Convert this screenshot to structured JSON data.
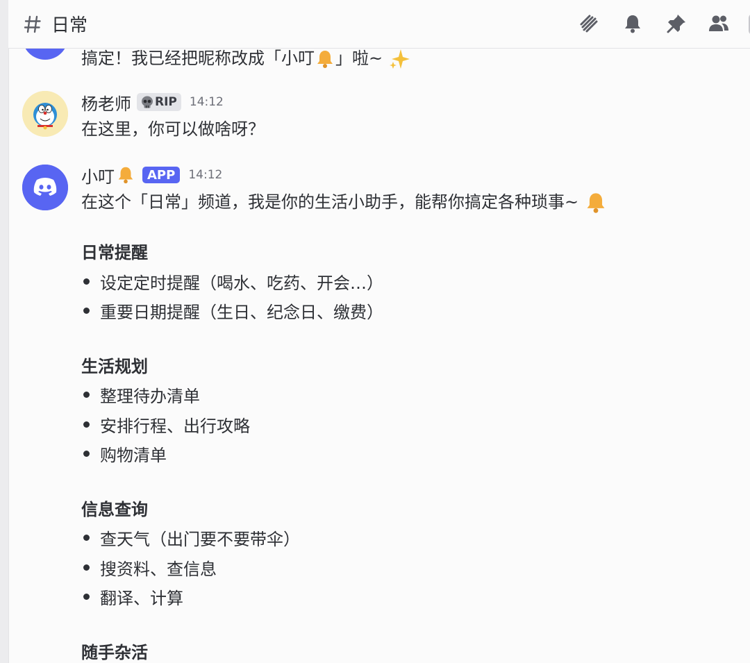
{
  "header": {
    "channel_name": "日常",
    "icons": [
      "threads-icon",
      "bell-icon",
      "pin-icon",
      "members-icon"
    ]
  },
  "messages": [
    {
      "partial_text": "搞定！我已经把昵称改成「小叮",
      "partial_text_tail": "」啦~"
    },
    {
      "username": "杨老师",
      "badge": "RIP",
      "timestamp": "14:12",
      "text": "在这里，你可以做啥呀？"
    },
    {
      "username": "小叮",
      "badge": "APP",
      "timestamp": "14:12",
      "intro": "在这个「日常」频道，我是你的生活小助手，能帮你搞定各种琐事~",
      "sections": [
        {
          "title": "日常提醒",
          "items": [
            "设定定时提醒（喝水、吃药、开会…）",
            "重要日期提醒（生日、纪念日、缴费）"
          ]
        },
        {
          "title": "生活规划",
          "items": [
            "整理待办清单",
            "安排行程、出行攻略",
            "购物清单"
          ]
        },
        {
          "title": "信息查询",
          "items": [
            "查天气（出门要不要带伞）",
            "搜资料、查信息",
            "翻译、计算"
          ]
        },
        {
          "title": "随手杂活",
          "items": []
        }
      ]
    }
  ],
  "colors": {
    "accent": "#5865f2",
    "bell": "#f4ac3b",
    "text": "#2e3035",
    "muted": "#6d6f78"
  }
}
